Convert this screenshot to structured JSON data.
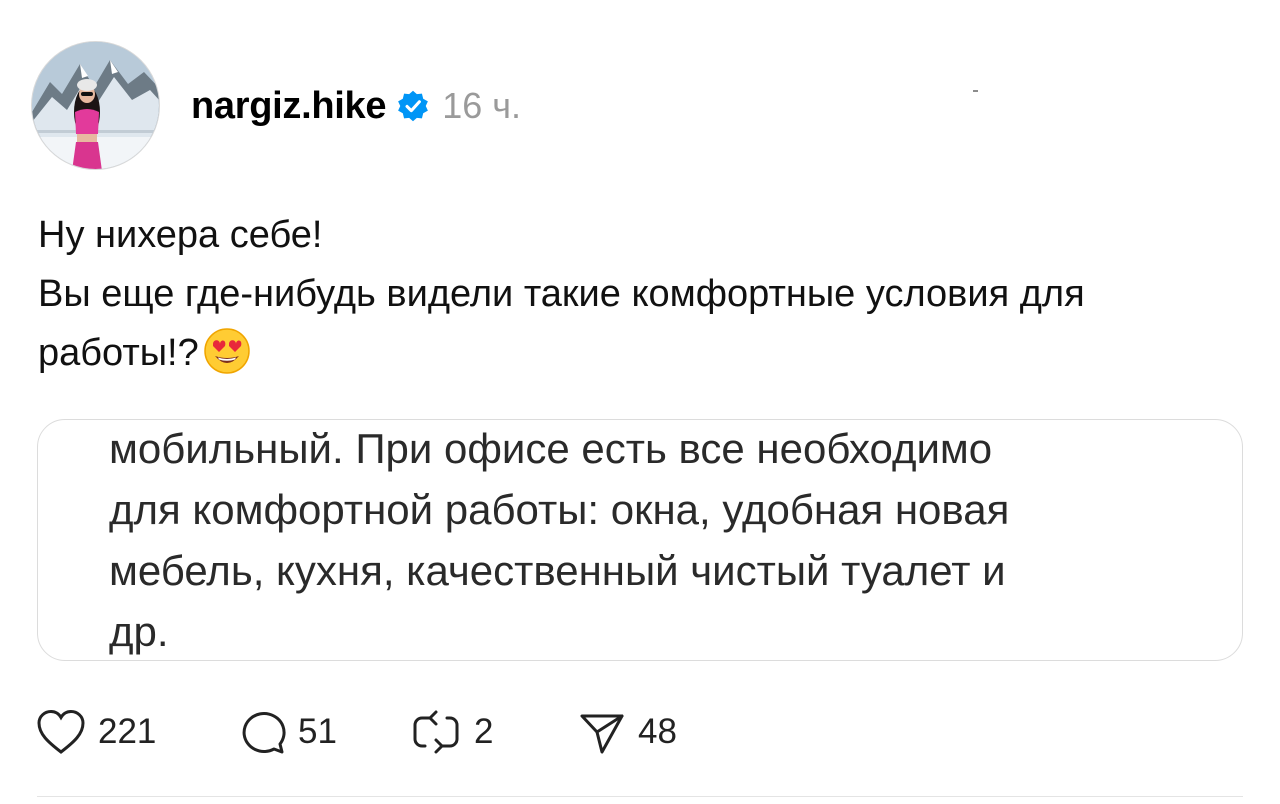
{
  "post": {
    "author": {
      "username": "nargiz.hike",
      "verified": true,
      "avatar_icon": "avatar-photo"
    },
    "timestamp": "16 ч.",
    "text_lines": [
      "Ну нихера себе!",
      "Вы еще где-нибудь видели такие комфортные условия для работы!?"
    ],
    "emoji_icon": "heart-eyes-emoji",
    "media_text": "мобильный. При офисе есть все необходимо\nдля комфортной работы: окна, удобная новая\nмебель, кухня, качественный чистый туалет и\nдр."
  },
  "actions": {
    "like_count": "221",
    "reply_count": "51",
    "repost_count": "2",
    "share_count": "48"
  },
  "colors": {
    "verified_badge": "#0095f6",
    "timestamp": "#9a9a9a",
    "card_border": "#dcdcdc"
  }
}
